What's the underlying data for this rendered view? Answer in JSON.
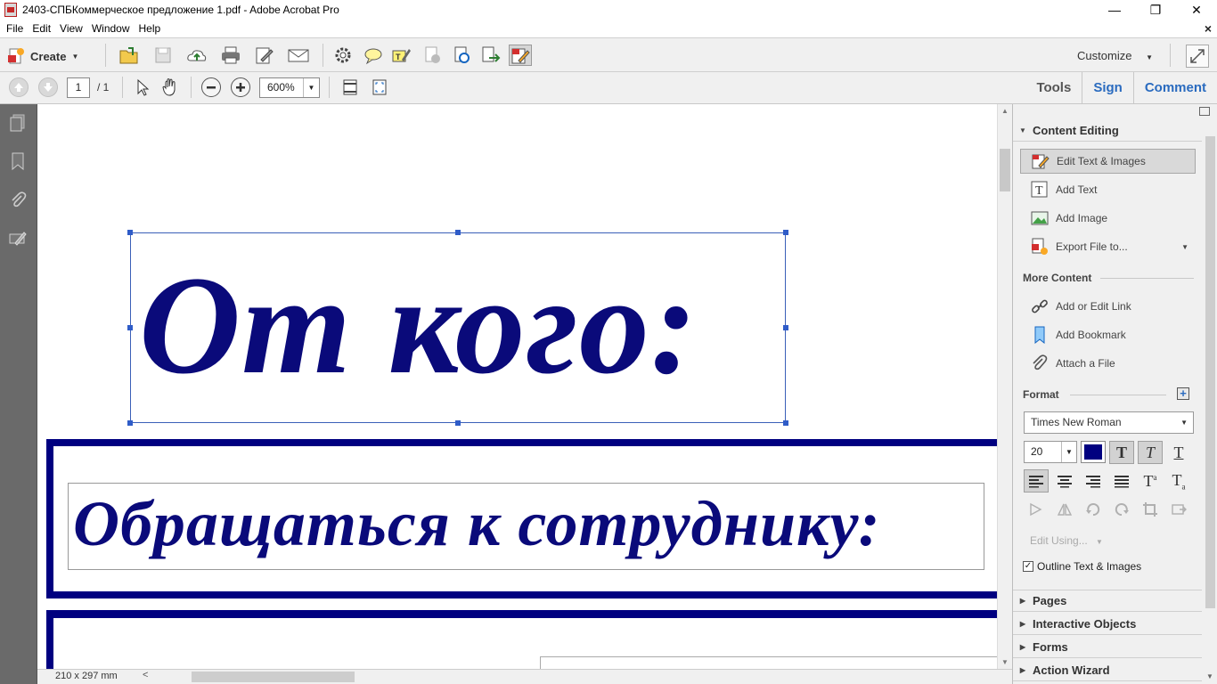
{
  "window": {
    "title": "2403-СПБКоммерческое предложение 1.pdf - Adobe Acrobat Pro",
    "min": "—",
    "max": "❐",
    "close": "✕"
  },
  "menu": {
    "items": [
      "File",
      "Edit",
      "View",
      "Window",
      "Help"
    ],
    "close_doc": "×"
  },
  "toolbar": {
    "create_label": "Create",
    "customize_label": "Customize"
  },
  "nav": {
    "page_current": "1",
    "page_total": "/ 1",
    "zoom": "600%",
    "links": {
      "tools": "Tools",
      "sign": "Sign",
      "comment": "Comment"
    }
  },
  "document": {
    "heading": "От кого:",
    "subheading": "Обращаться к сотруднику:",
    "page_size": "210 x 297 mm",
    "text_color": "#0a0a7a"
  },
  "panel": {
    "content_editing": "Content Editing",
    "items": [
      {
        "label": "Edit Text & Images",
        "icon": "edit-text-images-icon"
      },
      {
        "label": "Add Text",
        "icon": "add-text-icon"
      },
      {
        "label": "Add Image",
        "icon": "add-image-icon"
      },
      {
        "label": "Export File to...",
        "icon": "export-file-icon"
      }
    ],
    "more_content": "More Content",
    "more_items": [
      {
        "label": "Add or Edit Link",
        "icon": "link-icon"
      },
      {
        "label": "Add Bookmark",
        "icon": "bookmark-icon"
      },
      {
        "label": "Attach a File",
        "icon": "paperclip-icon"
      }
    ],
    "format": "Format",
    "font_name": "Times New Roman",
    "font_size": "20",
    "font_color": "#000080",
    "edit_using": "Edit Using...",
    "outline_label": "Outline Text & Images",
    "outline_checked": true,
    "sections": [
      "Pages",
      "Interactive Objects",
      "Forms",
      "Action Wizard"
    ]
  }
}
